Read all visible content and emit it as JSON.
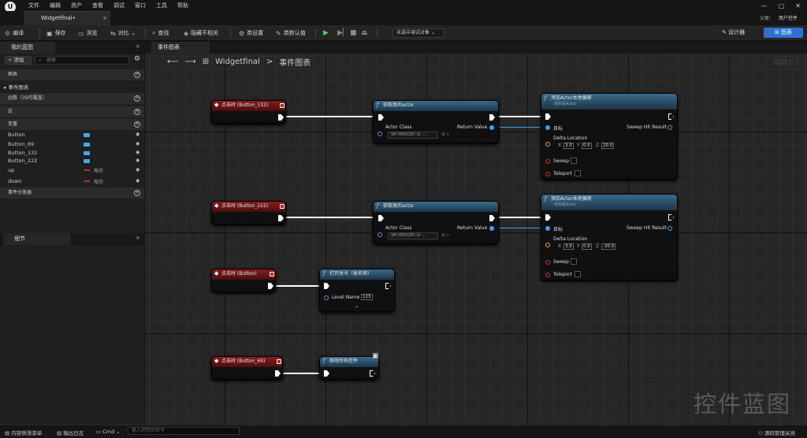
{
  "menu": {
    "items": [
      "文件",
      "编辑",
      "资产",
      "查看",
      "调试",
      "窗口",
      "工具",
      "帮助"
    ]
  },
  "tab": {
    "title": "Widgetfinal•"
  },
  "user": {
    "parent_label": "父类：",
    "parent_value": "用户控件"
  },
  "toolbar": {
    "compile": "编译",
    "save": "保存",
    "browse": "浏览",
    "diff": "对比 ⌄",
    "find": "查找",
    "hide": "隐藏不相关",
    "class_settings": "类设置",
    "class_defaults": "类默认值",
    "debug_target": "未选中调试对象",
    "designer": "设计器",
    "graph": "图表"
  },
  "left": {
    "tab": "我的蓝图",
    "add": "添加",
    "search_placeholder": "搜索",
    "sections": {
      "graphs": "图表",
      "functions": "函数（39可覆盖）",
      "macros": "宏",
      "variables": "变量",
      "dispatchers": "事件分发器"
    },
    "event_graph": "事件图表",
    "vars": [
      {
        "name": "Button",
        "type": ""
      },
      {
        "name": "Button_69",
        "type": ""
      },
      {
        "name": "Button_132",
        "type": ""
      },
      {
        "name": "Button_222",
        "type": ""
      },
      {
        "name": "up",
        "type": "布尔"
      },
      {
        "name": "down",
        "type": "布尔"
      }
    ]
  },
  "details": {
    "tab": "细节"
  },
  "graph": {
    "tab": "事件图表",
    "crumb_root": "Widgetfinal",
    "crumb_sep": ">",
    "crumb_leaf": "事件图表",
    "zoom": "缩放1:1",
    "watermark": "控件蓝图"
  },
  "nodes": {
    "ev1": "点击时 (Button_132)",
    "ev2": "点击时 (Button_222)",
    "ev3": "点击时 (Button)",
    "ev4": "点击时 (Button_69)",
    "get1": "获取类的actor",
    "get2": "获取类的actor",
    "actor_class": "Actor Class",
    "return_value": "Return Value",
    "combo": "SM MERGED Gr ⌄",
    "add1": "添加Actor本地偏移",
    "add2": "添加Actor本地偏移",
    "target_sub": "目标是Actor",
    "target": "目标",
    "sweep_hit": "Sweep Hit Result",
    "delta": "Delta Location",
    "sweep": "Sweep",
    "teleport": "Teleport",
    "d1": {
      "x": "3.0",
      "y": "0.0",
      "z": "20.0"
    },
    "d2": {
      "x": "3.0",
      "y": "0.0",
      "z": "-20.0"
    },
    "xl": "X",
    "yl": "Y",
    "zl": "Z",
    "open": "打开关卡（按名称）",
    "level_name": "Level Name",
    "level_val": "123",
    "chev": "⌄",
    "remove": "移除所有控件"
  },
  "status": {
    "drawer": "内容侧滑菜单",
    "log": "输出日志",
    "cmd": "Cmd ⌄",
    "cmd_placeholder": "输入控制台命令",
    "source": "源码管理关闭"
  }
}
